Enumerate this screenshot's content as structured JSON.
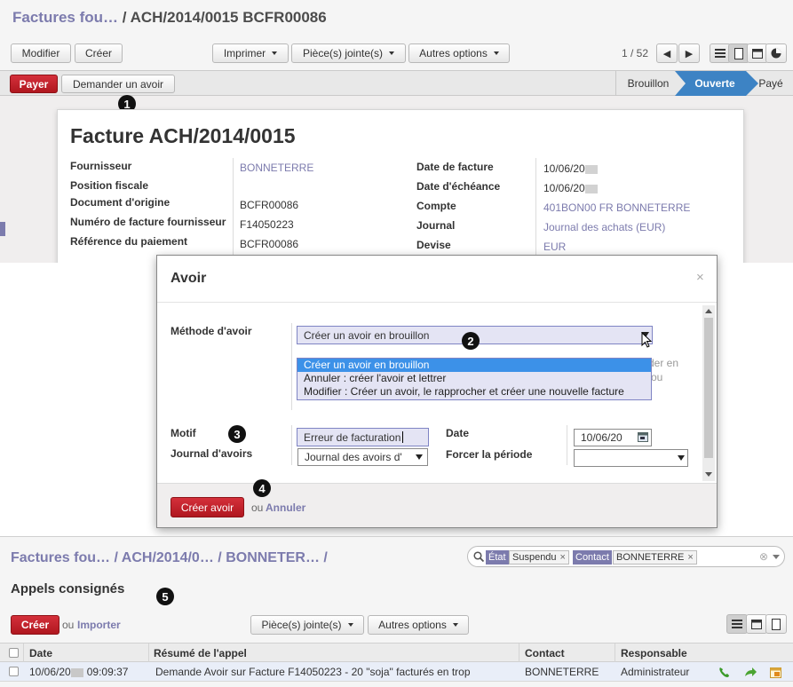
{
  "invoice": {
    "breadcrumb_parent": "Factures fou…",
    "breadcrumb_sep": "/",
    "breadcrumb_current": "ACH/2014/0015 BCFR00086",
    "buttons": {
      "edit": "Modifier",
      "create": "Créer",
      "print": "Imprimer",
      "attachments": "Pièce(s) jointe(s)",
      "more": "Autres options"
    },
    "pager": "1 / 52",
    "actions": {
      "pay": "Payer",
      "refund": "Demander un avoir"
    },
    "stages": [
      "Brouillon",
      "Ouverte",
      "Payé"
    ],
    "title": "Facture ACH/2014/0015",
    "left_fields": [
      {
        "label": "Fournisseur",
        "value": "BONNETERRE"
      },
      {
        "label": "Position fiscale",
        "value": ""
      },
      {
        "label": "Document d'origine",
        "value": "BCFR00086"
      },
      {
        "label": "Numéro de facture fournisseur",
        "value": "F14050223"
      },
      {
        "label": "Référence du paiement",
        "value": "BCFR00086"
      }
    ],
    "right_fields": [
      {
        "label": "Date de facture",
        "value": "10/06/20"
      },
      {
        "label": "Date d'échéance",
        "value": "10/06/20"
      },
      {
        "label": "Compte",
        "value": "401BON00 FR BONNETERRE"
      },
      {
        "label": "Journal",
        "value": "Journal des achats (EUR)"
      },
      {
        "label": "Devise",
        "value": "EUR"
      }
    ]
  },
  "dialog": {
    "title": "Avoir",
    "close": "×",
    "method_label": "Méthode d'avoir",
    "method_value": "Créer un avoir en brouillon",
    "method_options": [
      "Créer un avoir en brouillon",
      "Annuler : créer l'avoir et lettrer",
      "Modifier : Créer un avoir, le rapprocher et créer une nouvelle facture"
    ],
    "hidden_text_1": "der en",
    "hidden_text_2": "ou",
    "reason_label": "Motif",
    "reason_value": "Erreur de facturation",
    "journal_label": "Journal d'avoirs",
    "journal_value": "Journal des avoirs d'",
    "date_label": "Date",
    "date_value": "10/06/20",
    "period_label": "Forcer la période",
    "period_value": "",
    "submit": "Créer avoir",
    "or": "ou",
    "cancel": "Annuler"
  },
  "calls": {
    "breadcrumb": [
      "Factures fou…",
      "ACH/2014/0…",
      "BONNETER…"
    ],
    "breadcrumb_sep": "/",
    "search_facets": [
      {
        "key": "État",
        "value": "Suspendu"
      },
      {
        "key": "Contact",
        "value": "BONNETERRE"
      }
    ],
    "title": "Appels consignés",
    "create": "Créer",
    "or": "ou",
    "import": "Importer",
    "attachments": "Pièce(s) jointe(s)",
    "more": "Autres options",
    "columns": [
      "Date",
      "Résumé de l'appel",
      "Contact",
      "Responsable"
    ],
    "rows": [
      {
        "date": "10/06/20",
        "time": "09:09:37",
        "summary": "Demande Avoir sur Facture F14050223 - 20 \"soja\" facturés en trop",
        "contact": "BONNETERRE",
        "responsible": "Administrateur"
      }
    ]
  },
  "callouts": [
    "1",
    "2",
    "3",
    "4",
    "5"
  ],
  "colors": {
    "accent": "#7c7bad",
    "danger": "#c0222b",
    "selection": "#3c91e8",
    "stage_active": "#3d83c4"
  }
}
